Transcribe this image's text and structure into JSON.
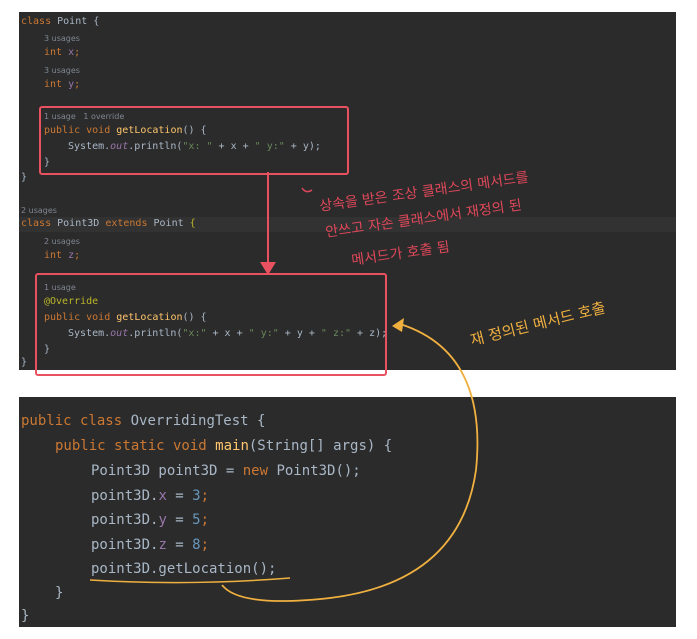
{
  "top_code": {
    "class_point": [
      "class",
      "Point",
      "{"
    ],
    "usages_x": "3 usages",
    "field_x": [
      "int",
      "x",
      ";"
    ],
    "usages_y": "3 usages",
    "field_y": [
      "int",
      "y",
      ";"
    ],
    "usage_hint_1": "1 usage   1 override",
    "method_1": [
      "public void",
      "getLocation",
      "() {"
    ],
    "println_1": [
      "System.",
      "out",
      ".println(",
      "\"x: \"",
      " + x + ",
      "\" y:\"",
      " + y);"
    ],
    "close_brace_inner": "}",
    "close_brace_class": "}",
    "usages_point3d": "2 usages",
    "class_point3d": [
      "class",
      "Point3D",
      "extends",
      "Point",
      "{"
    ],
    "usages_z": "2 usages",
    "field_z": [
      "int",
      "z",
      ";"
    ],
    "usage_hint_2": "1 usage",
    "override": "@Override",
    "method_2": [
      "public void",
      "getLocation",
      "() {"
    ],
    "println_2": [
      "System.",
      "out",
      ".println(",
      "\"x:\"",
      " + x + ",
      "\" y:\"",
      " + y + ",
      "\" z:\"",
      " + z);"
    ],
    "close_brace_inner_2": "}",
    "close_brace_class_2": "}"
  },
  "bottom_code": {
    "line1": [
      "public class",
      "OverridingTest {"
    ],
    "line2": [
      "public static void",
      "main",
      "(String[] args) {"
    ],
    "line3": [
      "Point3D point3D = ",
      "new",
      " Point3D();"
    ],
    "line4": [
      "point3D.",
      "x",
      " = ",
      "3",
      ";"
    ],
    "line5": [
      "point3D.",
      "y",
      " = ",
      "5",
      ";"
    ],
    "line6": [
      "point3D.",
      "z",
      " = ",
      "8",
      ";"
    ],
    "line7": [
      "point3D.getLocation();"
    ],
    "line8": "}",
    "line9": "}"
  },
  "annotations": {
    "red_note_1": "상속을 받은 조상 클래스의 메서드를",
    "red_note_2": "안쓰고 자손 클래스에서 재정의 된",
    "red_note_3": "메서드가 호출 됨",
    "orange_note": "재 정의된 메서드 호출"
  },
  "colors": {
    "editor_bg": "#2b2b2b",
    "keyword": "#cc7832",
    "string": "#6a8759",
    "red_annotation": "#e8515f",
    "orange_annotation": "#f0b040"
  }
}
